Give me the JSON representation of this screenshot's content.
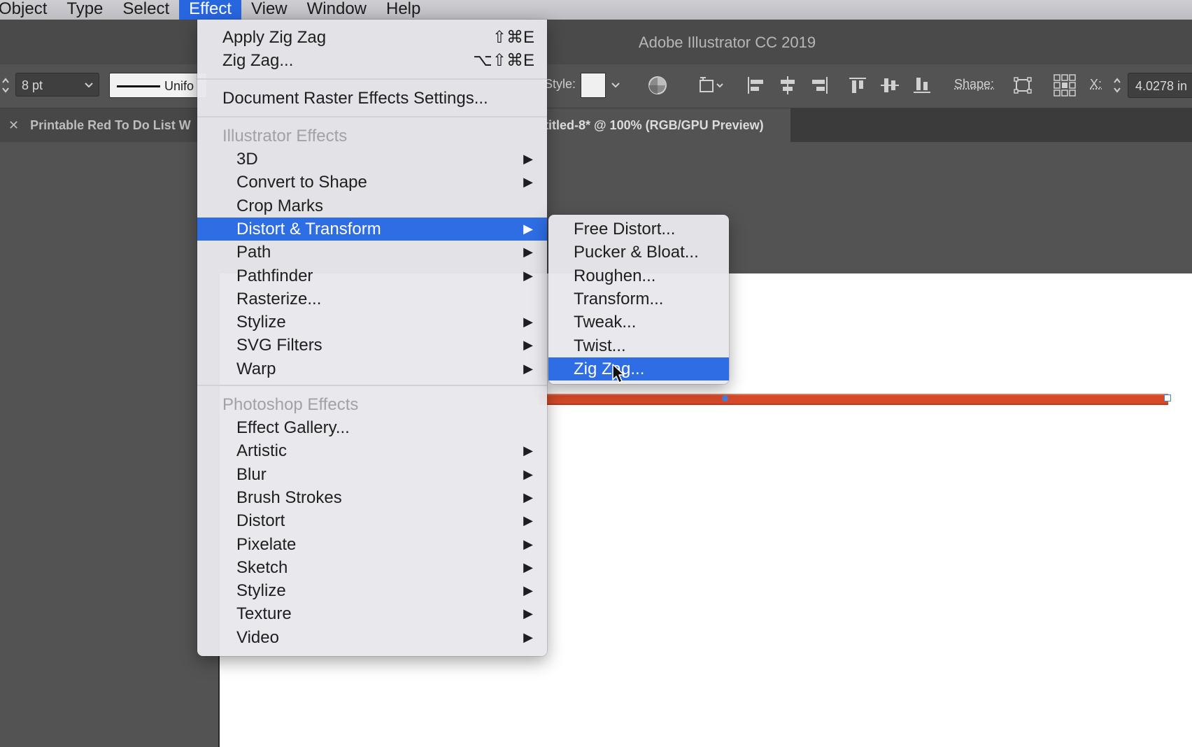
{
  "menubar": {
    "items": [
      "Object",
      "Type",
      "Select",
      "Effect",
      "View",
      "Window",
      "Help"
    ],
    "active": "Effect"
  },
  "window": {
    "title": "Adobe Illustrator CC 2019"
  },
  "controlbar": {
    "stroke_weight": "8 pt",
    "stroke_profile": "Unifo",
    "style_label": "Style:",
    "shape_label": "Shape:",
    "x_label": "X:",
    "x_value": "4.0278 in"
  },
  "tabs": [
    {
      "label": "Printable Red To Do List W",
      "close": "✕"
    },
    {
      "label": "Untitled-8* @ 100% (RGB/GPU Preview)"
    }
  ],
  "effect_menu": {
    "apply": {
      "label": "Apply Zig Zag",
      "shortcut": "⇧⌘E"
    },
    "last": {
      "label": "Zig Zag...",
      "shortcut": "⌥⇧⌘E"
    },
    "raster_settings": "Document Raster Effects Settings...",
    "illustrator_header": "Illustrator Effects",
    "illustrator_items": [
      {
        "label": "3D",
        "submenu": true
      },
      {
        "label": "Convert to Shape",
        "submenu": true
      },
      {
        "label": "Crop Marks",
        "submenu": false
      },
      {
        "label": "Distort & Transform",
        "submenu": true,
        "highlighted": true
      },
      {
        "label": "Path",
        "submenu": true
      },
      {
        "label": "Pathfinder",
        "submenu": true
      },
      {
        "label": "Rasterize...",
        "submenu": false
      },
      {
        "label": "Stylize",
        "submenu": true
      },
      {
        "label": "SVG Filters",
        "submenu": true
      },
      {
        "label": "Warp",
        "submenu": true
      }
    ],
    "photoshop_header": "Photoshop Effects",
    "photoshop_items": [
      {
        "label": "Effect Gallery...",
        "submenu": false
      },
      {
        "label": "Artistic",
        "submenu": true
      },
      {
        "label": "Blur",
        "submenu": true
      },
      {
        "label": "Brush Strokes",
        "submenu": true
      },
      {
        "label": "Distort",
        "submenu": true
      },
      {
        "label": "Pixelate",
        "submenu": true
      },
      {
        "label": "Sketch",
        "submenu": true
      },
      {
        "label": "Stylize",
        "submenu": true
      },
      {
        "label": "Texture",
        "submenu": true
      },
      {
        "label": "Video",
        "submenu": true
      }
    ]
  },
  "distort_submenu": {
    "items": [
      {
        "label": "Free Distort..."
      },
      {
        "label": "Pucker & Bloat..."
      },
      {
        "label": "Roughen..."
      },
      {
        "label": "Transform..."
      },
      {
        "label": "Tweak..."
      },
      {
        "label": "Twist..."
      },
      {
        "label": "Zig Zag...",
        "highlighted": true
      }
    ]
  },
  "colors": {
    "accent": "#2e6de3",
    "stroke_red": "#d64a2a"
  },
  "icons": {
    "submenu_arrow": "▶",
    "chevron_down": "⌄"
  }
}
